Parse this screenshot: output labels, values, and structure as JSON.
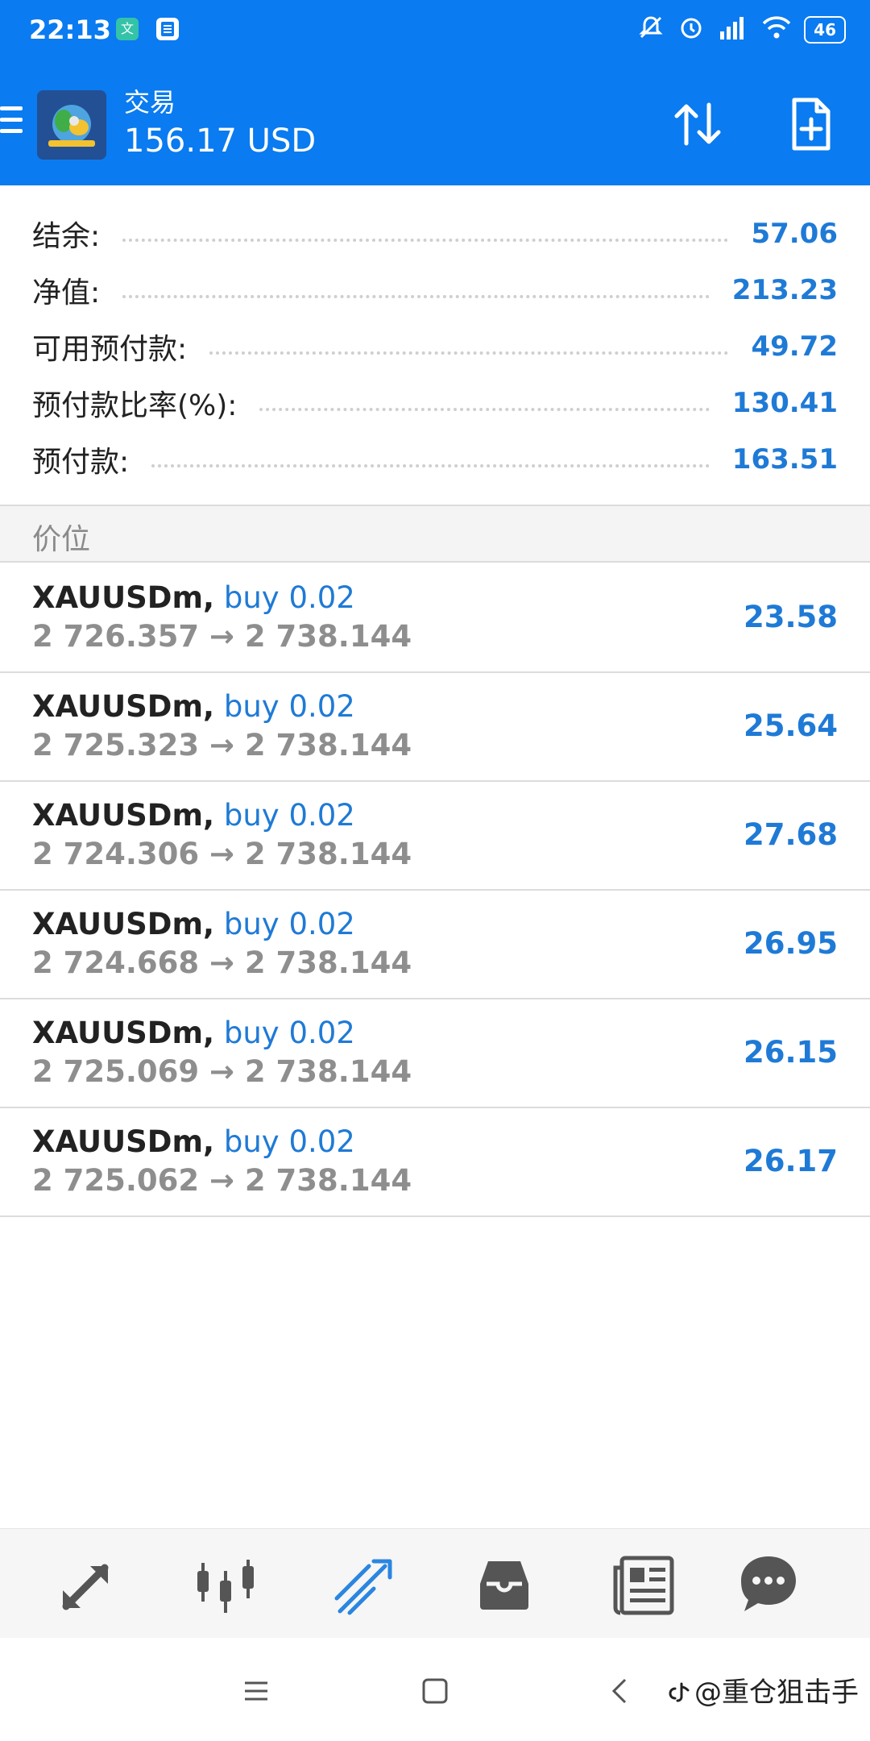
{
  "status": {
    "time": "22:13",
    "app_icon_1": "文",
    "battery": "46"
  },
  "header": {
    "title": "交易",
    "balance": "156.17 USD"
  },
  "summary": [
    {
      "label": "结余:",
      "value": "57.06"
    },
    {
      "label": "净值:",
      "value": "213.23"
    },
    {
      "label": "可用预付款:",
      "value": "49.72"
    },
    {
      "label": "预付款比率(%):",
      "value": "130.41"
    },
    {
      "label": "预付款:",
      "value": "163.51"
    }
  ],
  "section_title": "价位",
  "positions": [
    {
      "symbol": "XAUUSDm,",
      "type": "buy 0.02",
      "prices": "2 726.357 → 2 738.144",
      "profit": "23.58"
    },
    {
      "symbol": "XAUUSDm,",
      "type": "buy 0.02",
      "prices": "2 725.323 → 2 738.144",
      "profit": "25.64"
    },
    {
      "symbol": "XAUUSDm,",
      "type": "buy 0.02",
      "prices": "2 724.306 → 2 738.144",
      "profit": "27.68"
    },
    {
      "symbol": "XAUUSDm,",
      "type": "buy 0.02",
      "prices": "2 724.668 → 2 738.144",
      "profit": "26.95"
    },
    {
      "symbol": "XAUUSDm,",
      "type": "buy 0.02",
      "prices": "2 725.069 → 2 738.144",
      "profit": "26.15"
    },
    {
      "symbol": "XAUUSDm,",
      "type": "buy 0.02",
      "prices": "2 725.062 → 2 738.144",
      "profit": "26.17"
    }
  ],
  "tabs": [
    {
      "name": "quotes-icon",
      "active": false
    },
    {
      "name": "chart-icon",
      "active": false
    },
    {
      "name": "trade-icon",
      "active": true
    },
    {
      "name": "history-icon",
      "active": false
    },
    {
      "name": "news-icon",
      "active": false
    },
    {
      "name": "messages-icon",
      "active": false
    }
  ],
  "watermark": "@重仓狙击手",
  "colors": {
    "primary": "#0a7bf0",
    "accent_text": "#1f7ad6",
    "inactive_icon": "#555555"
  }
}
